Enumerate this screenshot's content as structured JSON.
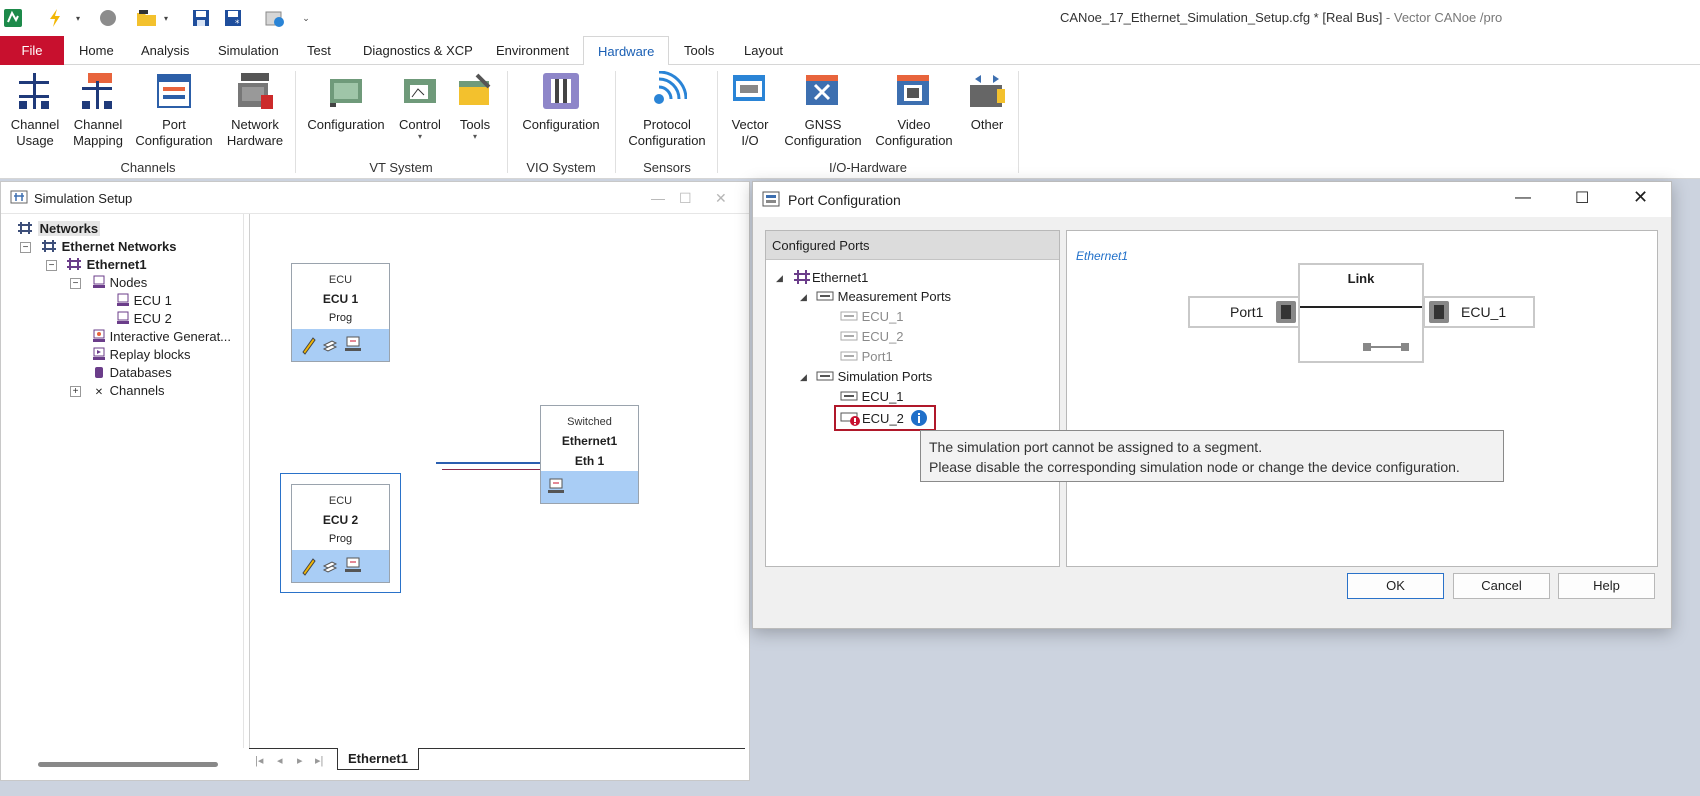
{
  "window": {
    "title_main": "CANoe_17_Ethernet_Simulation_Setup.cfg * [Real Bus]",
    "title_suffix": " - Vector CANoe /pro"
  },
  "ribbon_tabs": [
    "File",
    "Home",
    "Analysis",
    "Simulation",
    "Test",
    "Diagnostics & XCP",
    "Environment",
    "Hardware",
    "Tools",
    "Layout"
  ],
  "active_tab": "Hardware",
  "ribbon": {
    "channel_usage": [
      "Channel",
      "Usage"
    ],
    "channel_mapping": [
      "Channel",
      "Mapping"
    ],
    "port_configuration": [
      "Port",
      "Configuration"
    ],
    "network_hardware": [
      "Network",
      "Hardware"
    ],
    "vt_configuration": "Configuration",
    "vt_control": "Control",
    "vt_tools": "Tools",
    "vio_configuration": "Configuration",
    "protocol_configuration": [
      "Protocol",
      "Configuration"
    ],
    "vector_io": [
      "Vector",
      "I/O"
    ],
    "gnss_configuration": [
      "GNSS",
      "Configuration"
    ],
    "video_configuration": [
      "Video",
      "Configuration"
    ],
    "other": "Other",
    "groups": {
      "channels": "Channels",
      "vt_system": "VT System",
      "vio_system": "VIO System",
      "sensors": "Sensors",
      "io_hardware": "I/O-Hardware"
    }
  },
  "sim_setup": {
    "title": "Simulation Setup",
    "tree": {
      "networks": "Networks",
      "ethernet_networks": "Ethernet Networks",
      "ethernet1": "Ethernet1",
      "nodes": "Nodes",
      "ecu1": "ECU 1",
      "ecu2": "ECU 2",
      "interactive_generators": "Interactive Generat...",
      "replay_blocks": "Replay blocks",
      "databases": "Databases",
      "channels": "Channels"
    },
    "node1": {
      "type": "ECU",
      "name": "ECU 1",
      "sub": "Prog"
    },
    "node2": {
      "type": "ECU",
      "name": "ECU 2",
      "sub": "Prog"
    },
    "switch": {
      "type": "Switched",
      "name": "Ethernet1",
      "sub": "Eth 1"
    },
    "sheet_tab": "Ethernet1"
  },
  "port_config": {
    "title": "Port Configuration",
    "configured_ports_header": "Configured Ports",
    "tree": {
      "root": "Ethernet1",
      "measurement_ports": "Measurement Ports",
      "meas_items": [
        "ECU_1",
        "ECU_2",
        "Port1"
      ],
      "simulation_ports": "Simulation Ports",
      "sim_ecu1": "ECU_1",
      "sim_ecu2": "ECU_2"
    },
    "detail": {
      "network_label": "Ethernet1",
      "link_label": "Link",
      "left_port": "Port1",
      "right_port": "ECU_1"
    },
    "tooltip": {
      "line1": "The simulation port cannot be assigned to a segment.",
      "line2": "Please disable the corresponding simulation node or change the device configuration."
    },
    "buttons": {
      "ok": "OK",
      "cancel": "Cancel",
      "help": "Help"
    }
  },
  "colors": {
    "file_tab": "#c8102e",
    "accent": "#1a5fb4",
    "node_bar": "#a9cdf5",
    "error_highlight": "#b0182a"
  }
}
